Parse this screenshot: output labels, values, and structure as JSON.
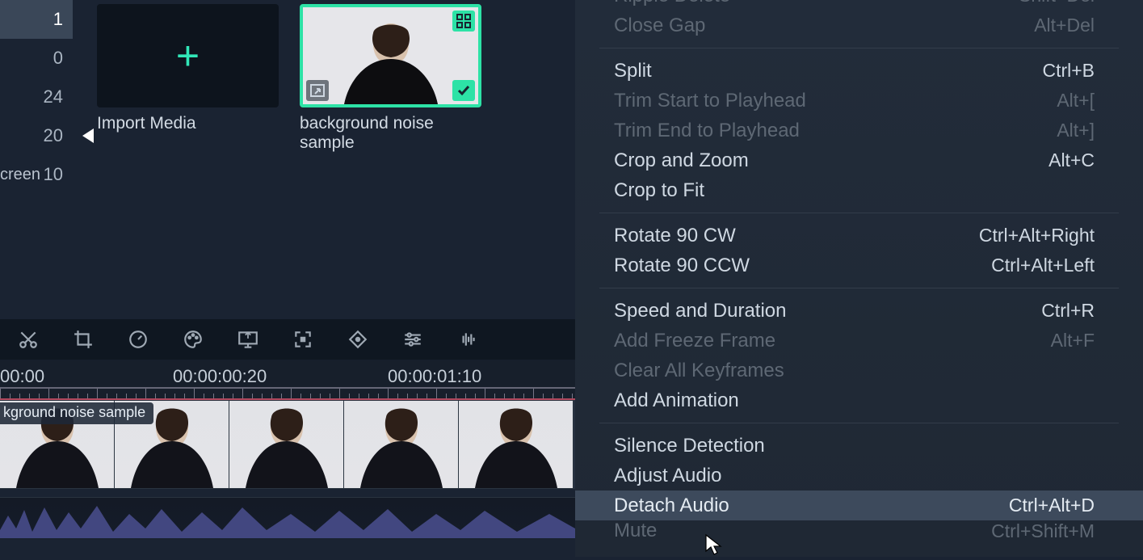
{
  "sidebar": {
    "rows": [
      {
        "val": "1",
        "highlight": true
      },
      {
        "val": "0"
      },
      {
        "val": "24"
      },
      {
        "val": "20",
        "showPlay": true
      },
      {
        "val": "10",
        "left": "creen"
      }
    ]
  },
  "media": {
    "import_label": "Import Media",
    "clip_label": "background noise sample"
  },
  "ruler": {
    "t0": "00:00",
    "t1": "00:00:00:20",
    "t2": "00:00:01:10"
  },
  "timeline": {
    "clip_label": "kground noise sample"
  },
  "menu": [
    {
      "type": "item",
      "label": "Ripple Delete",
      "shortcut": "Shift+Del",
      "state": "disabled",
      "cut": true
    },
    {
      "type": "item",
      "label": "Close Gap",
      "shortcut": "Alt+Del",
      "state": "disabled"
    },
    {
      "type": "sep"
    },
    {
      "type": "item",
      "label": "Split",
      "shortcut": "Ctrl+B",
      "state": "enabled"
    },
    {
      "type": "item",
      "label": "Trim Start to Playhead",
      "shortcut": "Alt+[",
      "state": "disabled"
    },
    {
      "type": "item",
      "label": "Trim End to Playhead",
      "shortcut": "Alt+]",
      "state": "disabled"
    },
    {
      "type": "item",
      "label": "Crop and Zoom",
      "shortcut": "Alt+C",
      "state": "enabled"
    },
    {
      "type": "item",
      "label": "Crop to Fit",
      "shortcut": "",
      "state": "enabled"
    },
    {
      "type": "sep"
    },
    {
      "type": "item",
      "label": "Rotate 90 CW",
      "shortcut": "Ctrl+Alt+Right",
      "state": "enabled"
    },
    {
      "type": "item",
      "label": "Rotate 90 CCW",
      "shortcut": "Ctrl+Alt+Left",
      "state": "enabled"
    },
    {
      "type": "sep"
    },
    {
      "type": "item",
      "label": "Speed and Duration",
      "shortcut": "Ctrl+R",
      "state": "enabled"
    },
    {
      "type": "item",
      "label": "Add Freeze Frame",
      "shortcut": "Alt+F",
      "state": "disabled"
    },
    {
      "type": "item",
      "label": "Clear All Keyframes",
      "shortcut": "",
      "state": "disabled"
    },
    {
      "type": "item",
      "label": "Add Animation",
      "shortcut": "",
      "state": "enabled"
    },
    {
      "type": "sep"
    },
    {
      "type": "item",
      "label": "Silence Detection",
      "shortcut": "",
      "state": "enabled"
    },
    {
      "type": "item",
      "label": "Adjust Audio",
      "shortcut": "",
      "state": "enabled"
    },
    {
      "type": "item",
      "label": "Detach Audio",
      "shortcut": "Ctrl+Alt+D",
      "state": "highlight"
    },
    {
      "type": "item",
      "label": "Mute",
      "shortcut": "Ctrl+Shift+M",
      "state": "disabled",
      "cut": true
    }
  ]
}
